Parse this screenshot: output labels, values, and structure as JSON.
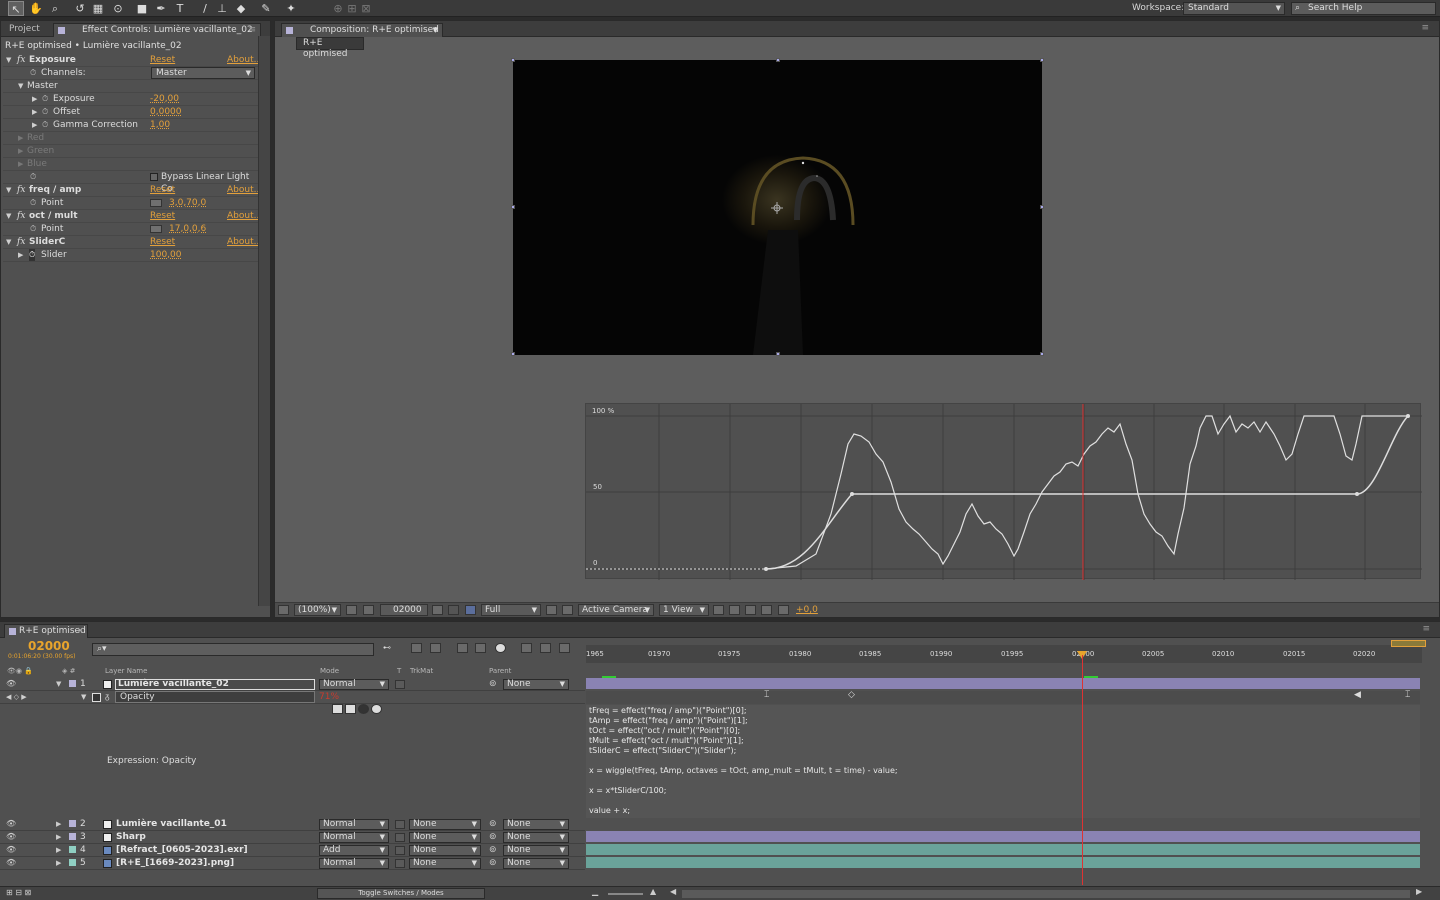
{
  "toolbar": {
    "workspace_label": "Workspace:",
    "workspace_value": "Standard",
    "search_placeholder": "Search Help"
  },
  "effect_controls": {
    "tab_project": "Project",
    "tab_effect": "Effect Controls: Lumière vacillante_02",
    "header": "R+E optimised • Lumière vacillante_02",
    "reset": "Reset",
    "about": "About...",
    "exposure": {
      "name": "Exposure",
      "channels_label": "Channels:",
      "channels_value": "Master",
      "master": "Master",
      "exposure_label": "Exposure",
      "exposure_value": "-20,00",
      "offset_label": "Offset",
      "offset_value": "0,0000",
      "gamma_label": "Gamma Correction",
      "gamma_value": "1,00",
      "red": "Red",
      "green": "Green",
      "blue": "Blue",
      "bypass": "Bypass Linear Light Co"
    },
    "freq_amp": {
      "name": "freq / amp",
      "point_label": "Point",
      "point_value": "3,0,70,0"
    },
    "oct_mult": {
      "name": "oct / mult",
      "point_label": "Point",
      "point_value": "17,0,0,6"
    },
    "sliderc": {
      "name": "SliderC",
      "slider_label": "Slider",
      "slider_value": "100,00"
    }
  },
  "composition": {
    "tab": "Composition: R+E optimised",
    "subtab": "R+E optimised",
    "graph_label_100": "100 %",
    "graph_label_50": "50",
    "graph_label_0": "0",
    "footer": {
      "zoom": "(100%)",
      "timecode": "02000",
      "resolution": "Full",
      "camera": "Active Camera",
      "views": "1 View",
      "exposure": "+0,0"
    }
  },
  "timeline": {
    "tab": "R+E optimised",
    "timecode": "02000",
    "timecode_sub": "0:01:06:20 (30.00 fps)",
    "search_placeholder": "",
    "columns": {
      "layer_name": "Layer Name",
      "mode": "Mode",
      "t": "T",
      "trkmat": "TrkMat",
      "parent": "Parent"
    },
    "ruler": [
      "1965",
      "01970",
      "01975",
      "01980",
      "01985",
      "01990",
      "01995",
      "02000",
      "02005",
      "02010",
      "02015",
      "02020"
    ],
    "layers": [
      {
        "num": "1",
        "name": "Lumière vacillante_02",
        "mode": "Normal",
        "trkmat": "",
        "parent": "None",
        "color": "#b7b3d8"
      },
      {
        "num": "2",
        "name": "Lumière vacillante_01",
        "mode": "Normal",
        "trkmat": "None",
        "parent": "None",
        "color": "#b7b3d8"
      },
      {
        "num": "3",
        "name": "Sharp",
        "mode": "Normal",
        "trkmat": "None",
        "parent": "None",
        "color": "#b7b3d8"
      },
      {
        "num": "4",
        "name": "[Refract_[0605-2023].exr]",
        "mode": "Add",
        "trkmat": "None",
        "parent": "None",
        "color": "#8fcfc2"
      },
      {
        "num": "5",
        "name": "[R+E_[1669-2023].png]",
        "mode": "Normal",
        "trkmat": "None",
        "parent": "None",
        "color": "#8fcfc2"
      }
    ],
    "opacity_label": "Opacity",
    "opacity_value": "71%",
    "expression_label": "Expression: Opacity",
    "expression": "tFreq = effect(\"freq / amp\")(\"Point\")[0];\ntAmp = effect(\"freq / amp\")(\"Point\")[1];\ntOct = effect(\"oct / mult\")(\"Point\")[0];\ntMult = effect(\"oct / mult\")(\"Point\")[1];\ntSliderC = effect(\"SliderC\")(\"Slider\");\n\nx = wiggle(tFreq, tAmp, octaves = tOct, amp_mult = tMult, t = time) - value;\n\nx = x*tSliderC/100;\n\nvalue + x;",
    "toggle": "Toggle Switches / Modes"
  }
}
